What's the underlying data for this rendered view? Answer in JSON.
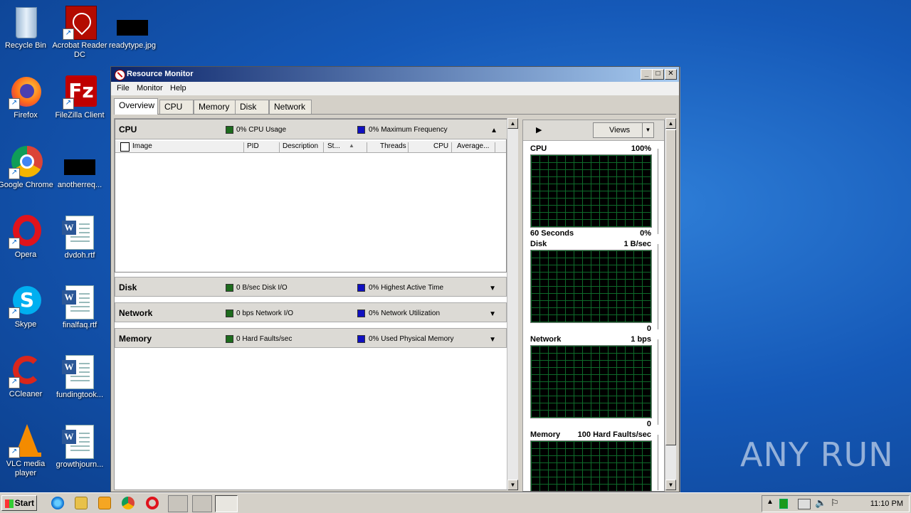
{
  "desktop": {
    "icons": [
      {
        "label": "Recycle Bin"
      },
      {
        "label": "Acrobat Reader DC"
      },
      {
        "label": "readytype.jpg"
      },
      {
        "label": "Firefox"
      },
      {
        "label": "FileZilla Client"
      },
      {
        "label": "Google Chrome"
      },
      {
        "label": "anotherreq..."
      },
      {
        "label": "Opera"
      },
      {
        "label": "dvdoh.rtf"
      },
      {
        "label": "Skype"
      },
      {
        "label": "finalfaq.rtf"
      },
      {
        "label": "CCleaner"
      },
      {
        "label": "fundingtook..."
      },
      {
        "label": "VLC media player"
      },
      {
        "label": "growthjourn..."
      }
    ]
  },
  "window": {
    "title": "Resource Monitor",
    "menu": [
      "File",
      "Monitor",
      "Help"
    ],
    "tabs": [
      "Overview",
      "CPU",
      "Memory",
      "Disk",
      "Network"
    ],
    "active_tab": "Overview"
  },
  "cpu_section": {
    "name": "CPU",
    "stat1": "0% CPU Usage",
    "stat2": "0% Maximum Frequency",
    "columns": [
      "Image",
      "PID",
      "Description",
      "St...",
      "Threads",
      "CPU",
      "Average..."
    ]
  },
  "sections": [
    {
      "name": "Disk",
      "stat1": "0 B/sec Disk I/O",
      "stat2": "0% Highest Active Time"
    },
    {
      "name": "Network",
      "stat1": "0 bps Network I/O",
      "stat2": "0% Network Utilization"
    },
    {
      "name": "Memory",
      "stat1": "0 Hard Faults/sec",
      "stat2": "0% Used Physical Memory"
    }
  ],
  "graphs_panel": {
    "views_label": "Views",
    "graphs": [
      {
        "name": "CPU",
        "max": "100%",
        "footer_left": "60 Seconds",
        "footer_right": "0%"
      },
      {
        "name": "Disk",
        "max": "1 B/sec",
        "footer_left": "",
        "footer_right": "0"
      },
      {
        "name": "Network",
        "max": "1 bps",
        "footer_left": "",
        "footer_right": "0"
      },
      {
        "name": "Memory",
        "max": "100 Hard Faults/sec",
        "footer_left": "",
        "footer_right": ""
      }
    ]
  },
  "taskbar": {
    "start_label": "Start",
    "clock": "11:10 PM"
  },
  "watermark": "ANY RUN",
  "colors": {
    "usage_square": "#1d6b1d",
    "max_square": "#1010c0",
    "grid_line": "#0e6a2a"
  }
}
